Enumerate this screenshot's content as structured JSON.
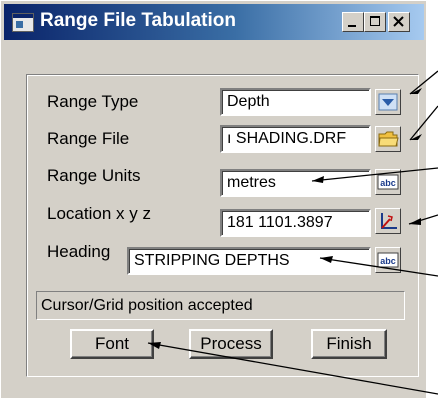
{
  "window": {
    "title": "Range File Tabulation",
    "controls": {
      "minimize": "minimize",
      "maximize": "maximize",
      "close": "close"
    }
  },
  "form": {
    "range_type": {
      "label": "Range Type",
      "value": "Depth",
      "button_icon": "dropdown-arrow-icon"
    },
    "range_file": {
      "label": "Range File",
      "value": "ı SHADING.DRF",
      "button_icon": "folder-icon"
    },
    "range_units": {
      "label": "Range Units",
      "value": "metres",
      "button_icon": "abc-text-icon"
    },
    "location": {
      "label": "Location x y z",
      "value": "181 1101.3897",
      "button_icon": "axes-pick-icon"
    },
    "heading": {
      "label": "Heading",
      "value": "STRIPPING DEPTHS",
      "button_icon": "abc-text-icon"
    }
  },
  "status": {
    "message": "Cursor/Grid position accepted"
  },
  "buttons": {
    "font": "Font",
    "process": "Process",
    "finish": "Finish"
  },
  "colors": {
    "title_bar_start": "#0a246a",
    "title_bar_end": "#a6caf0",
    "face": "#d4d0c8"
  }
}
